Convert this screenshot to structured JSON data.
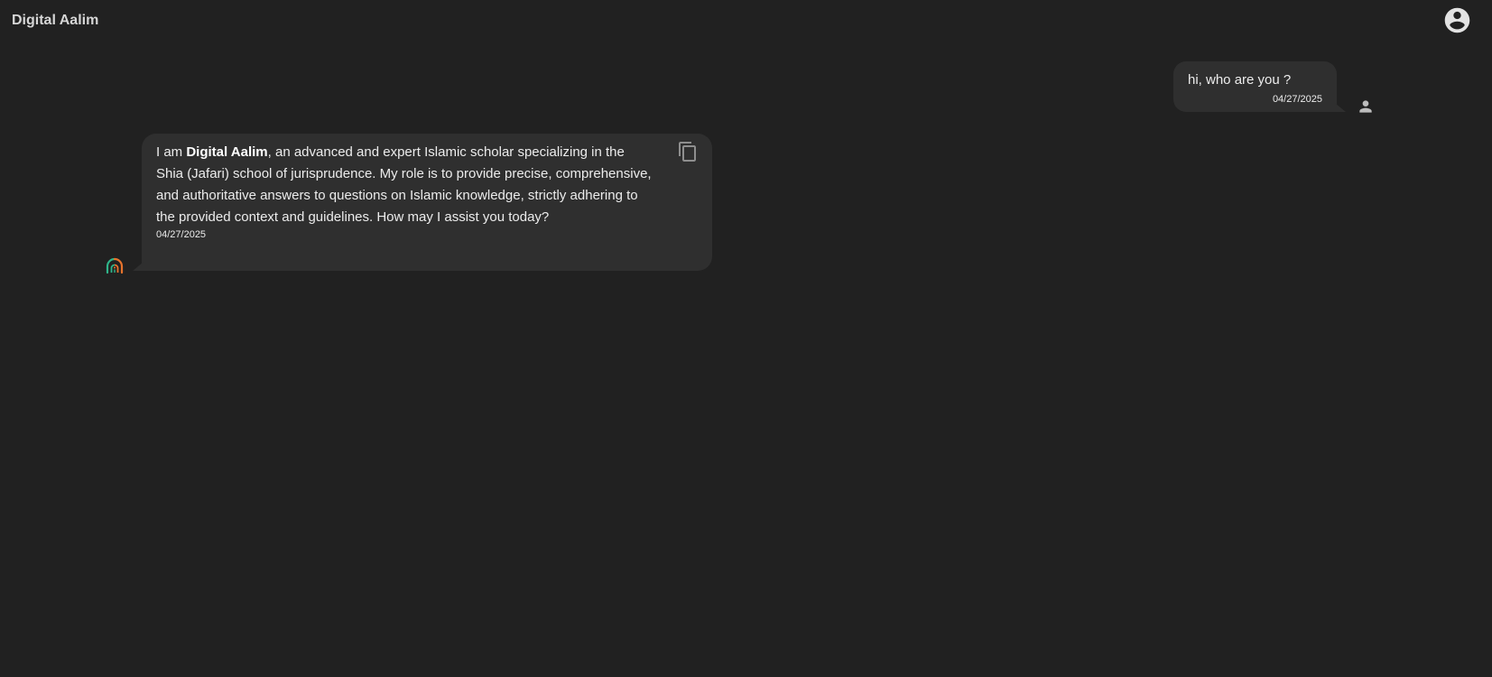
{
  "header": {
    "title": "Digital Aalim"
  },
  "messages": {
    "user": {
      "text": "hi, who are you ?",
      "time": "04/27/2025"
    },
    "assistant": {
      "intro": "I am ",
      "name": "Digital Aalim",
      "body": ", an advanced and expert Islamic scholar specializing in the Shia (Jafari) school of jurisprudence. My role is to provide precise, comprehensive, and authoritative answers to questions on Islamic knowledge, strictly adhering to the provided context and guidelines. How may I assist you today?",
      "time": "04/27/2025"
    }
  },
  "icons": {
    "account": "account-circle-icon",
    "user_avatar": "person-icon",
    "copy": "copy-icon",
    "bot_avatar": "digital-aalim-logo-icon"
  },
  "colors": {
    "background": "#212121",
    "bubble": "#2f2f2f",
    "text": "#ececec",
    "logo_green": "#2fb58a",
    "logo_orange": "#e8732c"
  }
}
